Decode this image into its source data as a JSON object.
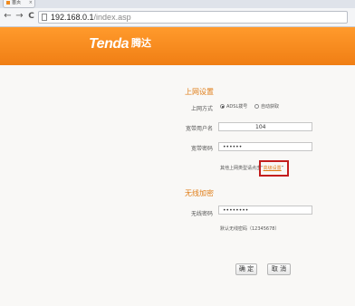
{
  "browser": {
    "tab_title": "首页",
    "tab_close": "×",
    "nav_back": "←",
    "nav_forward": "→",
    "nav_reload": "C",
    "url_host": "192.168.0.1",
    "url_path": "/index.asp"
  },
  "brand": {
    "logo_text": "Tenda",
    "logo_cn": "腾达"
  },
  "internet": {
    "section_title": "上网设置",
    "mode_label": "上网方式",
    "mode_options": [
      "ADSL拨号",
      "自动获取"
    ],
    "selected_mode": "ADSL拨号",
    "account_label": "宽带用户名",
    "account_value": "104",
    "password_label": "宽带密码",
    "password_value": "••••••",
    "hint_prefix": "其他上网类型请点击",
    "advanced_quote_open": "“",
    "advanced_link": "高级设置",
    "advanced_quote_close": "”"
  },
  "wireless": {
    "section_title": "无线加密",
    "password_label": "无线密码",
    "password_value": "••••••••",
    "default_hint": "默认无线密码（12345678）"
  },
  "buttons": {
    "confirm": "确 定",
    "cancel": "取 消"
  },
  "colors": {
    "accent": "#f28a1e",
    "highlight_box": "#c31d1d"
  }
}
